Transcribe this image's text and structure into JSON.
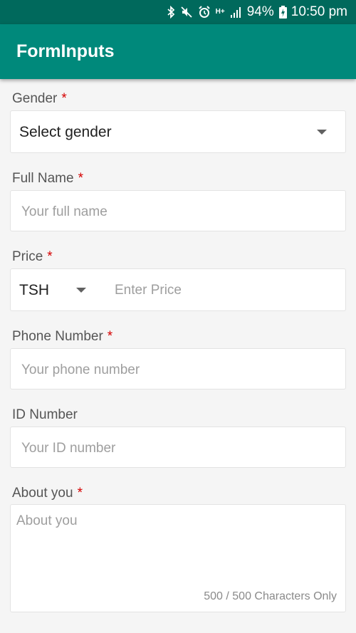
{
  "status_bar": {
    "battery": "94%",
    "time": "10:50 pm",
    "network": "H+",
    "icons": [
      "bluetooth-icon",
      "mute-icon",
      "alarm-icon",
      "network-type-icon",
      "signal-icon",
      "battery-charging-icon"
    ]
  },
  "app_bar": {
    "title": "FormInputs"
  },
  "form": {
    "required_marker": "*",
    "gender": {
      "label": "Gender",
      "value": "Select gender"
    },
    "full_name": {
      "label": "Full Name",
      "placeholder": "Your full name"
    },
    "price": {
      "label": "Price",
      "currency": "TSH",
      "placeholder": "Enter Price"
    },
    "phone": {
      "label": "Phone Number",
      "placeholder": "Your phone number"
    },
    "id_number": {
      "label": "ID Number",
      "placeholder": "Your ID number"
    },
    "about": {
      "label": "About you",
      "placeholder": "About you",
      "counter": "500 / 500 Characters Only"
    }
  },
  "colors": {
    "primary": "#00897b",
    "primary_dark": "#00695c",
    "required": "#d50000"
  }
}
